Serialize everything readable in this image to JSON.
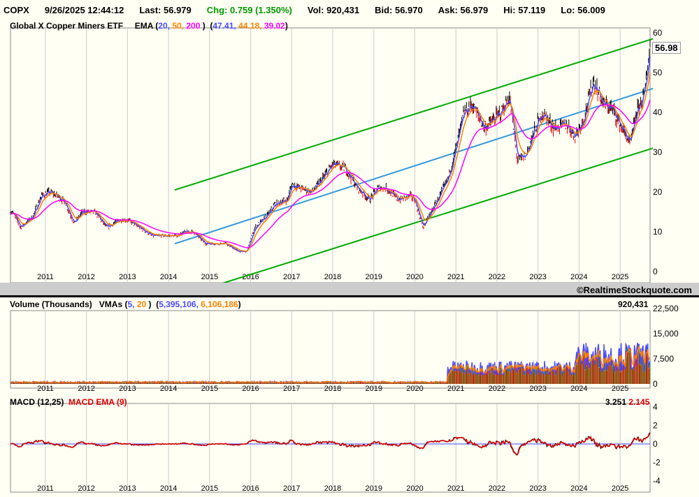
{
  "header": {
    "symbol": "COPX",
    "datetime": "9/26/2025 12:44:12",
    "last": "Last: 56.979",
    "chg": "Chg: 0.759 (1.350%)",
    "vol": "Vol: 920,431",
    "bid": "Bid: 56.970",
    "ask": "Ask: 56.979",
    "hi": "Hi: 57.119",
    "lo": "Lo: 56.009"
  },
  "price_panel": {
    "title": "Global X Copper Miners ETF",
    "ema_label": "EMA",
    "ema_periods": [
      "20,",
      "50,",
      "200"
    ],
    "ema_values": [
      "47.41,",
      "44.18,",
      "39.02"
    ],
    "last_badge": "56.98"
  },
  "volume_panel": {
    "title": "Volume (Thousands)",
    "vma_label": "VMAs",
    "vma_periods": [
      "5,",
      "20"
    ],
    "vma_values": [
      "5,395,106,",
      "6,106,186"
    ],
    "last_value": "920,431"
  },
  "macd_panel": {
    "title": "MACD (12,25)",
    "ema_title": "MACD EMA (9)",
    "macd_value": "3.251",
    "signal_value": "2.145"
  },
  "copyright": "©RealtimeStockquote.com",
  "colors": {
    "up": "#000000",
    "down": "#e00000",
    "ema20": "#4a4aff",
    "ema50": "#ff8000",
    "ema200": "#ff00ff",
    "channel": "#00aa00",
    "mid": "#3399dd",
    "macd": "#000000",
    "signal": "#e00000",
    "zero": "#4444ff"
  },
  "chart_data": [
    {
      "type": "line",
      "title": "Global X Copper Miners ETF (price)",
      "x_range": [
        2010.15,
        2025.73
      ],
      "ylim": [
        0,
        60
      ],
      "x_ticks": [
        "2011",
        "2012",
        "2013",
        "2014",
        "2015",
        "2016",
        "2017",
        "2018",
        "2019",
        "2020",
        "2021",
        "2022",
        "2023",
        "2024",
        "2025"
      ],
      "y_ticks": [
        "0",
        "10",
        "20",
        "30",
        "40",
        "50",
        "60"
      ],
      "price_keypoints": [
        [
          2010.2,
          15
        ],
        [
          2010.4,
          11
        ],
        [
          2010.7,
          14
        ],
        [
          2010.9,
          19
        ],
        [
          2011.1,
          20
        ],
        [
          2011.3,
          19
        ],
        [
          2011.5,
          17
        ],
        [
          2011.7,
          12
        ],
        [
          2011.9,
          15
        ],
        [
          2012.2,
          15
        ],
        [
          2012.5,
          11
        ],
        [
          2012.8,
          13
        ],
        [
          2013.0,
          13
        ],
        [
          2013.3,
          11
        ],
        [
          2013.6,
          9
        ],
        [
          2013.9,
          9
        ],
        [
          2014.2,
          9
        ],
        [
          2014.4,
          10
        ],
        [
          2014.6,
          10
        ],
        [
          2014.9,
          7
        ],
        [
          2015.2,
          7
        ],
        [
          2015.4,
          7
        ],
        [
          2015.7,
          5
        ],
        [
          2015.9,
          5
        ],
        [
          2016.1,
          11
        ],
        [
          2016.4,
          14
        ],
        [
          2016.6,
          17
        ],
        [
          2016.9,
          18
        ],
        [
          2017.0,
          22
        ],
        [
          2017.2,
          21
        ],
        [
          2017.5,
          20
        ],
        [
          2017.8,
          24
        ],
        [
          2018.0,
          27
        ],
        [
          2018.3,
          26
        ],
        [
          2018.6,
          21
        ],
        [
          2018.9,
          18
        ],
        [
          2019.1,
          21
        ],
        [
          2019.3,
          21
        ],
        [
          2019.6,
          18
        ],
        [
          2019.9,
          19
        ],
        [
          2020.0,
          18
        ],
        [
          2020.2,
          11
        ],
        [
          2020.5,
          17
        ],
        [
          2020.8,
          23
        ],
        [
          2021.0,
          31
        ],
        [
          2021.2,
          40
        ],
        [
          2021.4,
          42
        ],
        [
          2021.7,
          36
        ],
        [
          2021.9,
          38
        ],
        [
          2022.1,
          40
        ],
        [
          2022.3,
          44
        ],
        [
          2022.5,
          28
        ],
        [
          2022.7,
          29
        ],
        [
          2022.9,
          35
        ],
        [
          2023.1,
          40
        ],
        [
          2023.4,
          36
        ],
        [
          2023.7,
          37
        ],
        [
          2023.9,
          34
        ],
        [
          2024.1,
          38
        ],
        [
          2024.35,
          48
        ],
        [
          2024.6,
          42
        ],
        [
          2024.8,
          41
        ],
        [
          2025.0,
          37
        ],
        [
          2025.25,
          32
        ],
        [
          2025.4,
          40
        ],
        [
          2025.6,
          45
        ],
        [
          2025.73,
          57
        ]
      ],
      "trend_lines": [
        {
          "name": "upper channel",
          "from": [
            2014.15,
            20.5
          ],
          "to": [
            2025.8,
            58.5
          ]
        },
        {
          "name": "middle",
          "from": [
            2014.15,
            7
          ],
          "to": [
            2025.8,
            46
          ]
        },
        {
          "name": "lower channel",
          "from": [
            2015.3,
            -3
          ],
          "to": [
            2025.8,
            31
          ]
        }
      ],
      "last": 56.98
    },
    {
      "type": "bar",
      "title": "Volume (Thousands)",
      "ylim": [
        0,
        22500
      ],
      "y_ticks": [
        "0",
        "7,500",
        "15,000",
        "22,500"
      ]
    },
    {
      "type": "line",
      "title": "MACD (12,25)",
      "ylim": [
        -4,
        4
      ],
      "y_ticks": [
        "-4",
        "-2",
        "0",
        "2",
        "4"
      ],
      "macd": 3.251,
      "signal": 2.145
    }
  ]
}
